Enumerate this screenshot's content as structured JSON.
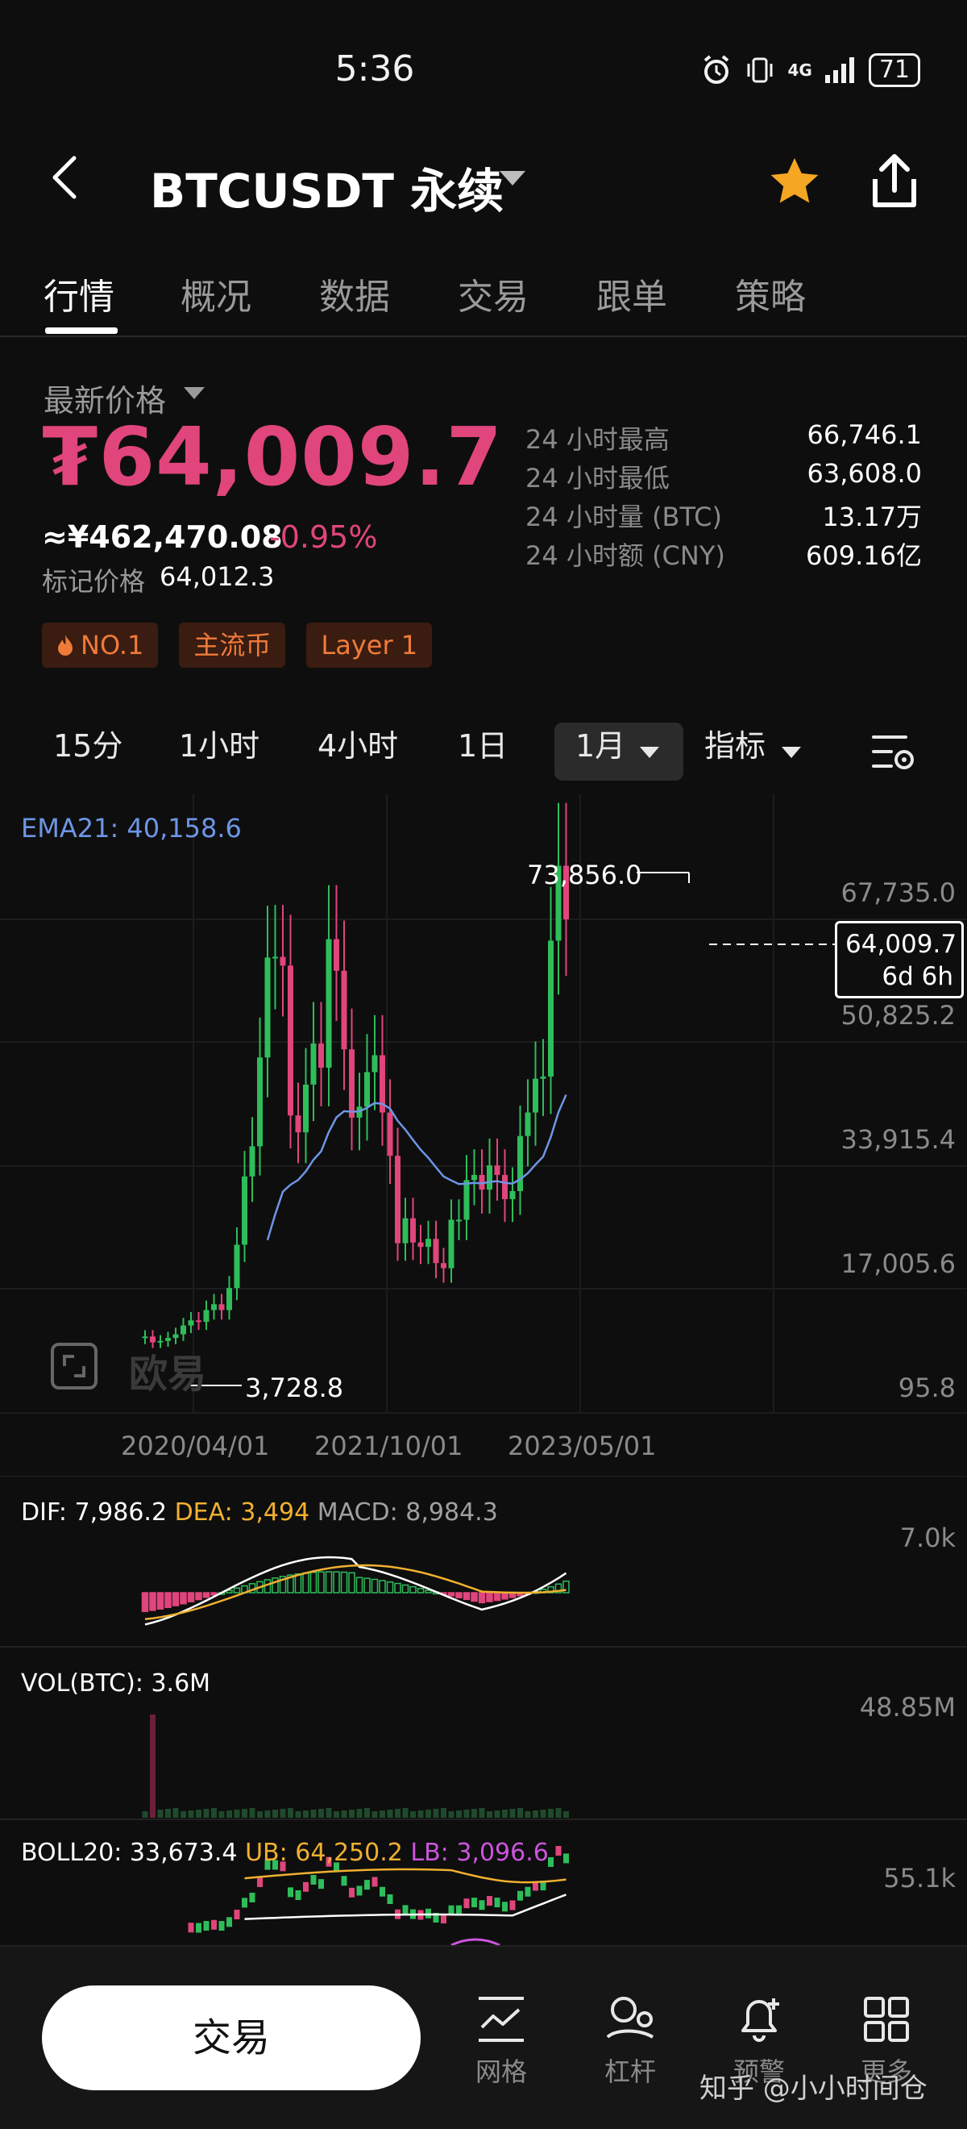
{
  "status_bar": {
    "time": "5:36",
    "network": "4G",
    "battery": "71",
    "icons": [
      "alarm-icon",
      "vibrate-icon",
      "signal-icon",
      "battery-icon"
    ]
  },
  "header": {
    "title": "BTCUSDT 永续",
    "icons": [
      "back-icon",
      "dropdown-caret-icon",
      "star-icon",
      "share-icon"
    ],
    "star_color": "#f5a623"
  },
  "tabs": [
    {
      "label": "行情",
      "active": true
    },
    {
      "label": "概况",
      "active": false
    },
    {
      "label": "数据",
      "active": false
    },
    {
      "label": "交易",
      "active": false
    },
    {
      "label": "跟单",
      "active": false
    },
    {
      "label": "策略",
      "active": false
    }
  ],
  "price": {
    "label": "最新价格",
    "last": "₮64,009.7",
    "cny": "≈¥462,470.08",
    "change": "-0.95%",
    "mark_label": "标记价格",
    "mark_value": "64,012.3",
    "color_down": "#e0457b"
  },
  "stats": [
    {
      "key": "24 小时最高",
      "value": "66,746.1"
    },
    {
      "key": "24 小时最低",
      "value": "63,608.0"
    },
    {
      "key": "24 小时量 (BTC)",
      "value": "13.17万"
    },
    {
      "key": "24 小时额 (CNY)",
      "value": "609.16亿"
    }
  ],
  "tags": [
    {
      "label": "NO.1",
      "icon": "fire-icon"
    },
    {
      "label": "主流币"
    },
    {
      "label": "Layer 1"
    }
  ],
  "timeframes": {
    "items": [
      "15分",
      "1小时",
      "4小时",
      "1日"
    ],
    "selected": "1月",
    "indicator": "指标"
  },
  "chart": {
    "ema_label": "EMA21: 40,158.6",
    "y_ticks": [
      "67,735.0",
      "50,825.2",
      "33,915.4",
      "17,005.6",
      "95.8"
    ],
    "x_ticks": [
      "2020/04/01",
      "2021/10/01",
      "2023/05/01"
    ],
    "high_marker": "73,856.0",
    "low_marker": "3,728.8",
    "current_price": "64,009.7",
    "countdown": "6d 6h",
    "watermark": "欧易",
    "up_color": "#2ebd5a",
    "down_color": "#e0457b",
    "ema_color": "#6e96e6"
  },
  "macd": {
    "dif": "DIF: 7,986.2",
    "dea": "DEA: 3,494",
    "macd": "MACD: 8,984.3",
    "y_tick": "7.0k"
  },
  "volume": {
    "label": "VOL(BTC): 3.6M",
    "y_tick": "48.85M"
  },
  "boll": {
    "label": "BOLL20: 33,673.4",
    "ub": "UB: 64,250.2",
    "lb": "LB: 3,096.6",
    "y_tick": "55.1k"
  },
  "bottom_nav": {
    "trade": "交易",
    "items": [
      {
        "label": "网格",
        "icon": "grid-chart-icon"
      },
      {
        "label": "杠杆",
        "icon": "leverage-icon"
      },
      {
        "label": "预警",
        "icon": "alert-bell-icon"
      },
      {
        "label": "更多",
        "icon": "more-grid-icon"
      }
    ],
    "credit": "知乎 @小小时间仓"
  }
}
